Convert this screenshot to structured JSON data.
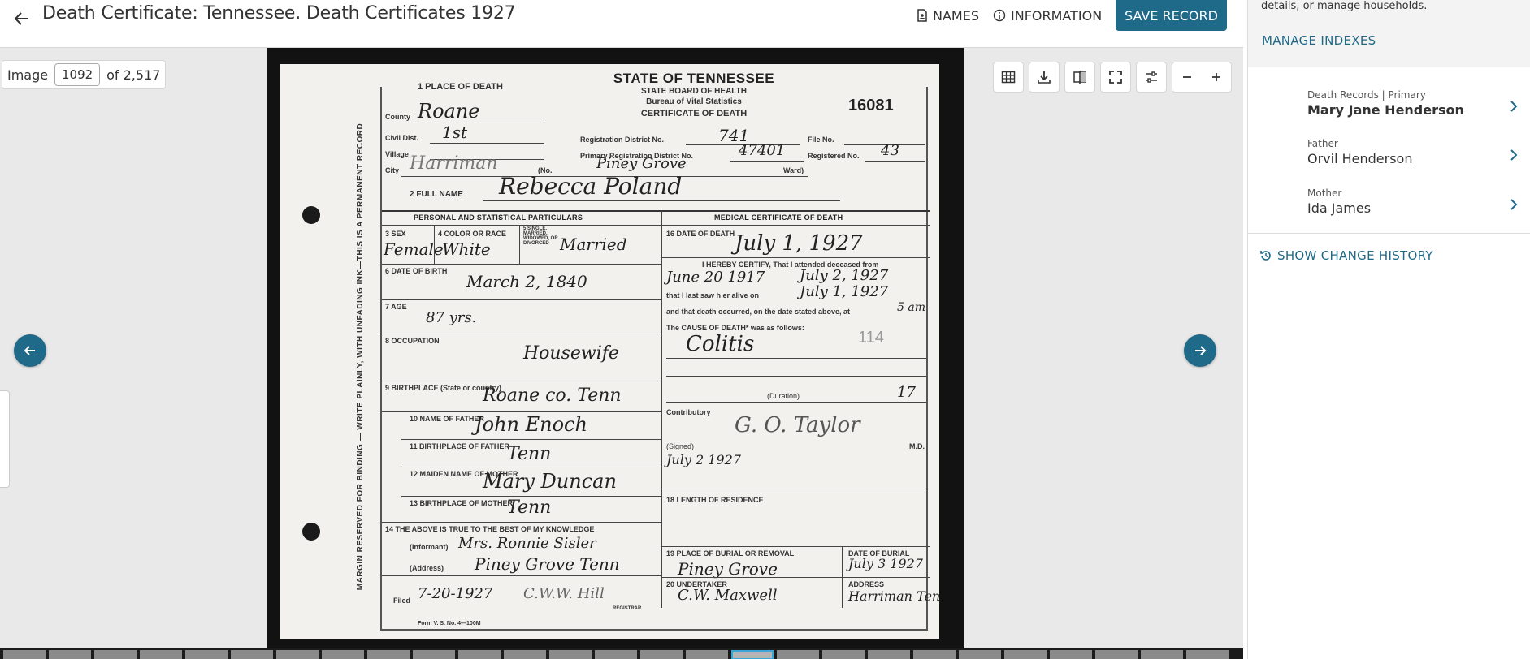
{
  "header": {
    "title": "Death Certificate: Tennessee. Death Certificates 1927",
    "names_label": "NAMES",
    "information_label": "INFORMATION",
    "save_label": "SAVE RECORD"
  },
  "viewer": {
    "image_label": "Image",
    "image_number": "1092",
    "image_total": "of 2,517",
    "document": {
      "state_title": "STATE OF TENNESSEE",
      "board": "STATE BOARD OF HEALTH",
      "bureau": "Bureau of Vital Statistics",
      "cert_label": "CERTIFICATE OF DEATH",
      "cert_number": "16081",
      "margin_note": "MARGIN RESERVED FOR BINDING — WRITE PLAINLY, WITH UNFADING INK—THIS IS A PERMANENT RECORD",
      "place_of_death_label": "1 PLACE OF DEATH",
      "county_label": "County",
      "county_value": "Roane",
      "civil_dist_label": "Civil Dist.",
      "civil_dist_value": "1st",
      "village_label": "Village",
      "city_label": "City",
      "city_value": "Harriman",
      "street_label": "(No.",
      "street_value": "Piney Grove",
      "ward_label": "Ward)",
      "reg_district_label": "Registration District No.",
      "reg_district_value": "741",
      "primary_reg_label": "Primary Registration District No.",
      "primary_reg_value": "47401",
      "file_no_label": "File No.",
      "registered_no_label": "Registered No.",
      "registered_no_value": "43",
      "full_name_label": "2 FULL NAME",
      "full_name_value": "Rebecca Poland",
      "personal_head": "PERSONAL AND STATISTICAL PARTICULARS",
      "medical_head": "MEDICAL CERTIFICATE OF DEATH",
      "sex_label": "3 SEX",
      "sex_value": "Female",
      "color_label": "4 COLOR OR RACE",
      "color_value": "White",
      "marital_label": "5 SINGLE, MARRIED, WIDOWED, OR DIVORCED",
      "marital_value": "Married",
      "dob_label": "6 DATE OF BIRTH",
      "dob_value": "March 2, 1840",
      "age_label": "7 AGE",
      "age_value": "87 yrs.",
      "occupation_label": "8 OCCUPATION",
      "occupation_value": "Housewife",
      "birthplace_label": "9 BIRTHPLACE (State or country)",
      "birthplace_value": "Roane co. Tenn",
      "father_label": "10 NAME OF FATHER",
      "father_value": "John Enoch",
      "father_birthplace_label": "11 BIRTHPLACE OF FATHER",
      "father_birthplace_value": "Tenn",
      "mother_label": "12 MAIDEN NAME OF MOTHER",
      "mother_value": "Mary Duncan",
      "mother_birthplace_label": "13 BIRTHPLACE OF MOTHER",
      "mother_birthplace_value": "Tenn",
      "informant_head": "14 THE ABOVE IS TRUE TO THE BEST OF MY KNOWLEDGE",
      "informant_label": "(Informant)",
      "informant_value": "Mrs. Ronnie Sisler",
      "address_label": "(Address)",
      "address_value": "Piney Grove Tenn",
      "filed_label": "Filed",
      "filed_value": "7-20-1927",
      "registrar_value": "C.W.W. Hill",
      "registrar_label": "REGISTRAR",
      "death_date_label": "16 DATE OF DEATH",
      "death_date_value": "July 1, 1927",
      "certify_text": "I HEREBY CERTIFY, That I attended deceased from",
      "attended_from": "June 20 1917",
      "attended_to": "July 2, 1927",
      "last_saw_label": "that I last saw h er alive on",
      "last_saw_value": "July 1, 1927",
      "death_time_text": "and that death occurred, on the date stated above, at",
      "death_time_value": "5 am",
      "cause_label": "The CAUSE OF DEATH* was as follows:",
      "cause_value": "Colitis",
      "cause_code": "114",
      "duration_label": "(Duration)",
      "duration_value": "17",
      "contributory_label": "Contributory",
      "signed_label": "(Signed)",
      "signed_value": "G. O. Taylor",
      "signed_date": "July 2 1927",
      "md_label": "M.D.",
      "residence_label": "18 LENGTH OF RESIDENCE",
      "burial_label": "19 PLACE OF BURIAL OR REMOVAL",
      "burial_value": "Piney Grove",
      "burial_date_label": "DATE OF BURIAL",
      "burial_date_value": "July 3 1927",
      "undertaker_label": "20 UNDERTAKER",
      "undertaker_value": "C.W. Maxwell",
      "undertaker_address_label": "ADDRESS",
      "undertaker_address_value": "Harriman Tenn",
      "form_footer": "Form V. S. No. 4—100M"
    }
  },
  "panel": {
    "description": "details, or manage households.",
    "manage_label": "MANAGE INDEXES",
    "people": [
      {
        "label": "Death Records | Primary",
        "name": "Mary Jane Henderson"
      },
      {
        "label": "Father",
        "name": "Orvil Henderson"
      },
      {
        "label": "Mother",
        "name": "Ida James"
      }
    ],
    "history_label": "SHOW CHANGE HISTORY"
  },
  "colors": {
    "accent": "#1f6a89",
    "viewer_bg": "#e9e9e9",
    "panel_top_bg": "#f3f3f3"
  },
  "icons": {
    "back": "arrow-left-icon",
    "names": "document-person-icon",
    "info": "info-circle-icon",
    "grid": "grid-icon",
    "download": "download-icon",
    "compare": "split-view-icon",
    "fullscreen": "fullscreen-icon",
    "adjust": "sliders-icon",
    "zoom_out": "minus-icon",
    "zoom_in": "plus-icon",
    "prev": "arrow-left-circle-icon",
    "next": "arrow-right-circle-icon",
    "chevron": "chevron-right-icon",
    "history": "history-icon"
  }
}
